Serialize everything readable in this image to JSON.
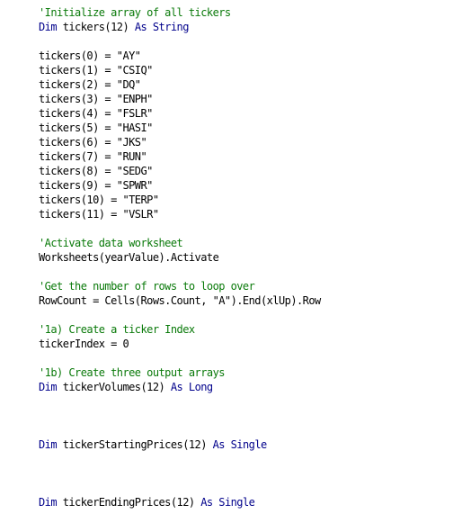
{
  "editor": {
    "colors": {
      "background": "#ffffff",
      "plain": "#000000",
      "comment": "#0a7a0a",
      "keyword": "#00008b"
    },
    "lines": [
      [
        {
          "t": "'Initialize array of all tickers",
          "k": "comment"
        }
      ],
      [
        {
          "t": "Dim",
          "k": "keyword"
        },
        {
          "t": " tickers(12) ",
          "k": "plain"
        },
        {
          "t": "As",
          "k": "keyword"
        },
        {
          "t": " ",
          "k": "plain"
        },
        {
          "t": "String",
          "k": "keyword"
        }
      ],
      [],
      [
        {
          "t": "tickers(0) = \"AY\"",
          "k": "plain"
        }
      ],
      [
        {
          "t": "tickers(1) = \"CSIQ\"",
          "k": "plain"
        }
      ],
      [
        {
          "t": "tickers(2) = \"DQ\"",
          "k": "plain"
        }
      ],
      [
        {
          "t": "tickers(3) = \"ENPH\"",
          "k": "plain"
        }
      ],
      [
        {
          "t": "tickers(4) = \"FSLR\"",
          "k": "plain"
        }
      ],
      [
        {
          "t": "tickers(5) = \"HASI\"",
          "k": "plain"
        }
      ],
      [
        {
          "t": "tickers(6) = \"JKS\"",
          "k": "plain"
        }
      ],
      [
        {
          "t": "tickers(7) = \"RUN\"",
          "k": "plain"
        }
      ],
      [
        {
          "t": "tickers(8) = \"SEDG\"",
          "k": "plain"
        }
      ],
      [
        {
          "t": "tickers(9) = \"SPWR\"",
          "k": "plain"
        }
      ],
      [
        {
          "t": "tickers(10) = \"TERP\"",
          "k": "plain"
        }
      ],
      [
        {
          "t": "tickers(11) = \"VSLR\"",
          "k": "plain"
        }
      ],
      [],
      [
        {
          "t": "'Activate data worksheet",
          "k": "comment"
        }
      ],
      [
        {
          "t": "Worksheets(yearValue).Activate",
          "k": "plain"
        }
      ],
      [],
      [
        {
          "t": "'Get the number of rows to loop over",
          "k": "comment"
        }
      ],
      [
        {
          "t": "RowCount = Cells(Rows.Count, \"A\").End(xlUp).Row",
          "k": "plain"
        }
      ],
      [],
      [
        {
          "t": "'1a) Create a ticker Index",
          "k": "comment"
        }
      ],
      [
        {
          "t": "tickerIndex = 0",
          "k": "plain"
        }
      ],
      [],
      [
        {
          "t": "'1b) Create three output arrays",
          "k": "comment"
        }
      ],
      [
        {
          "t": "Dim",
          "k": "keyword"
        },
        {
          "t": " tickerVolumes(12) ",
          "k": "plain"
        },
        {
          "t": "As",
          "k": "keyword"
        },
        {
          "t": " ",
          "k": "plain"
        },
        {
          "t": "Long",
          "k": "keyword"
        }
      ],
      [],
      [],
      [],
      [
        {
          "t": "Dim",
          "k": "keyword"
        },
        {
          "t": " tickerStartingPrices(12) ",
          "k": "plain"
        },
        {
          "t": "As",
          "k": "keyword"
        },
        {
          "t": " ",
          "k": "plain"
        },
        {
          "t": "Single",
          "k": "keyword"
        }
      ],
      [],
      [],
      [],
      [
        {
          "t": "Dim",
          "k": "keyword"
        },
        {
          "t": " tickerEndingPrices(12) ",
          "k": "plain"
        },
        {
          "t": "As",
          "k": "keyword"
        },
        {
          "t": " ",
          "k": "plain"
        },
        {
          "t": "Single",
          "k": "keyword"
        }
      ]
    ]
  }
}
